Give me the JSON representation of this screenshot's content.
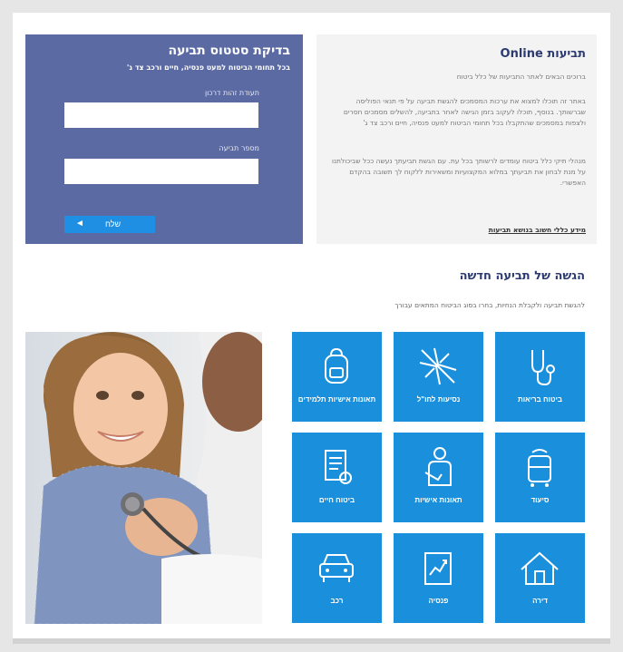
{
  "status_check": {
    "title": "בדיקת סטטוס תביעה",
    "subtitle": "בכל תחומי הביטוח למעט פנסיה, חיים ורכב צד ג'",
    "id_label": "תעודת זהות דרכון",
    "claim_label": "מספר תביעה",
    "id_value": "",
    "claim_value": "",
    "send_label": "שלח",
    "send_icon": "arrow-left-icon"
  },
  "online_claims": {
    "title": "תביעות Online",
    "intro": "ברוכים הבאים לאתר התביעות של כלל ביטוח",
    "paragraph1": "באתר זה תוכלו למצוא את ערכות המסמכים להגשת תביעה על פי תנאי הפוליסה שברשותך. בנוסף, תוכלו לעקוב בזמן הגישה לאחר בתביעה, להשלים מסמכים חסרים ולצפות במסמכים שהתקבלו בכל תחומי הביטוח למעט פנסיה, חיים ורכב צד ג'",
    "paragraph2": "מנהלי תיקי כלל ביטוח עומדים לרשותך בכל עת. עם הגשת תביעתך נעשה ככל שביכולתנו על מנת לבחון את תביעתך במלוא המקצועיות ומשאירות ללקוח לך תשובה בהקדם האפשרי.",
    "link": "מידע כללי חשוב בנושא תביעות"
  },
  "new_claim": {
    "title": "הגשה של תביעה חדשה",
    "subtitle": "להגשת תביעה ולקבלת הנחיות, בחרו בסוג הביטוח המתאים עבורך"
  },
  "tiles": [
    {
      "label": "ביטוח בריאות",
      "icon": "stethoscope-icon"
    },
    {
      "label": "נסיעות לחו\"ל",
      "icon": "airplane-icon"
    },
    {
      "label": "תאונות אישיות תלמידים",
      "icon": "backpack-icon"
    },
    {
      "label": "סיעוד",
      "icon": "walker-icon"
    },
    {
      "label": "תאונות אישיות",
      "icon": "injured-person-icon"
    },
    {
      "label": "ביטוח חיים",
      "icon": "document-icon"
    },
    {
      "label": "דירה",
      "icon": "house-icon"
    },
    {
      "label": "פנסיה",
      "icon": "chart-icon"
    },
    {
      "label": "רכב",
      "icon": "car-icon"
    }
  ],
  "colors": {
    "status_panel": "#5b6aa3",
    "tile": "#1a8fdc",
    "button": "#1f8fe3",
    "title": "#2c3a72"
  }
}
